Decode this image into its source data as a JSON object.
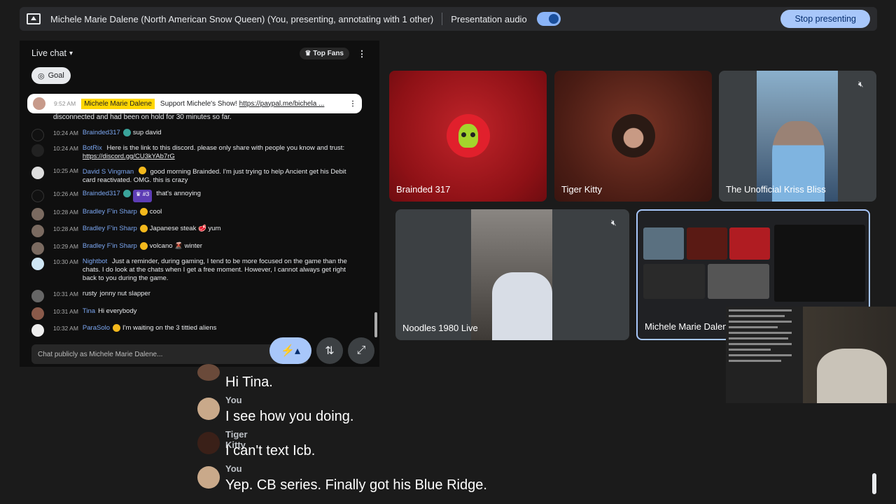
{
  "topbar": {
    "title": "Michele Marie Dalene (North American Snow Queen) (You, presenting, annotating with 1 other)",
    "audio_label": "Presentation audio",
    "stop_label": "Stop presenting",
    "accent": "#a8c7fa"
  },
  "chat": {
    "header": "Live chat",
    "top_fans": "Top Fans",
    "goal": "Goal",
    "pinned": {
      "time": "9:52 AM",
      "author": "Michele Marie Dalene",
      "text": "Support Michele's Show! ",
      "link": "https://paypal.me/bichela ..."
    },
    "truncated_text": "disconnected and had been on hold for 30 minutes so far.",
    "messages": [
      {
        "time": "10:24 AM",
        "author": "Brainded317",
        "text": "sup david",
        "rank": ""
      },
      {
        "time": "10:24 AM",
        "author": "BotRix",
        "text": "Here is the link to this discord. please only share with people you know and trust: ",
        "link": "https://discord.gg/CU3kYAb7rG",
        "rank": ""
      },
      {
        "time": "10:25 AM",
        "author": "David S Vingman",
        "text": "good morning Brainded. I'm just trying to help Ancient get his Debit card reactivated. OMG. this is crazy",
        "rank": ""
      },
      {
        "time": "10:26 AM",
        "author": "Brainded317",
        "text": "that's annoying",
        "rank": "#3"
      },
      {
        "time": "10:28 AM",
        "author": "Bradley F'in Sharp",
        "text": "cool",
        "rank": ""
      },
      {
        "time": "10:28 AM",
        "author": "Bradley F'in Sharp",
        "text": "Japanese steak 🥩 yum",
        "rank": ""
      },
      {
        "time": "10:29 AM",
        "author": "Bradley F'in Sharp",
        "text": "volcano 🌋 winter",
        "rank": ""
      },
      {
        "time": "10:30 AM",
        "author": "Nightbot",
        "text": "Just a reminder, during gaming, I tend to be more focused on the game than the chats. I do look at the chats when I get a free moment. However, I cannot always get right back to you during the game.",
        "rank": ""
      },
      {
        "time": "10:31 AM",
        "author": "rusty",
        "text": "jonny nut slapper",
        "rank": ""
      },
      {
        "time": "10:31 AM",
        "author": "Tina",
        "text": "Hi everybody",
        "rank": ""
      },
      {
        "time": "10:32 AM",
        "author": "ParaSolo",
        "text": "I'm waiting on the 3 tittied aliens",
        "rank": ""
      }
    ],
    "input_placeholder": "Chat publicly as Michele Marie Dalene..."
  },
  "tiles": [
    {
      "label": "Brainded 317"
    },
    {
      "label": "Tiger Kitty"
    },
    {
      "label": "The Unofficial Kriss Bliss"
    },
    {
      "label": "Noodles 1980 Live"
    },
    {
      "label": "Michele Marie Dalene"
    }
  ],
  "captions": [
    {
      "who": "",
      "line": "Hi Tina."
    },
    {
      "who": "You",
      "line": "I see how you doing."
    },
    {
      "who": "Tiger Kitty",
      "line": "I can't text Icb."
    },
    {
      "who": "You",
      "line": "Yep. CB series. Finally got his Blue Ridge."
    }
  ],
  "icons": [
    "present-icon",
    "chevron-down-icon",
    "crown-icon",
    "more-vert-icon",
    "goal-icon",
    "sparkle-icon",
    "swap-vert-icon",
    "expand-icon",
    "mic-off-icon"
  ]
}
